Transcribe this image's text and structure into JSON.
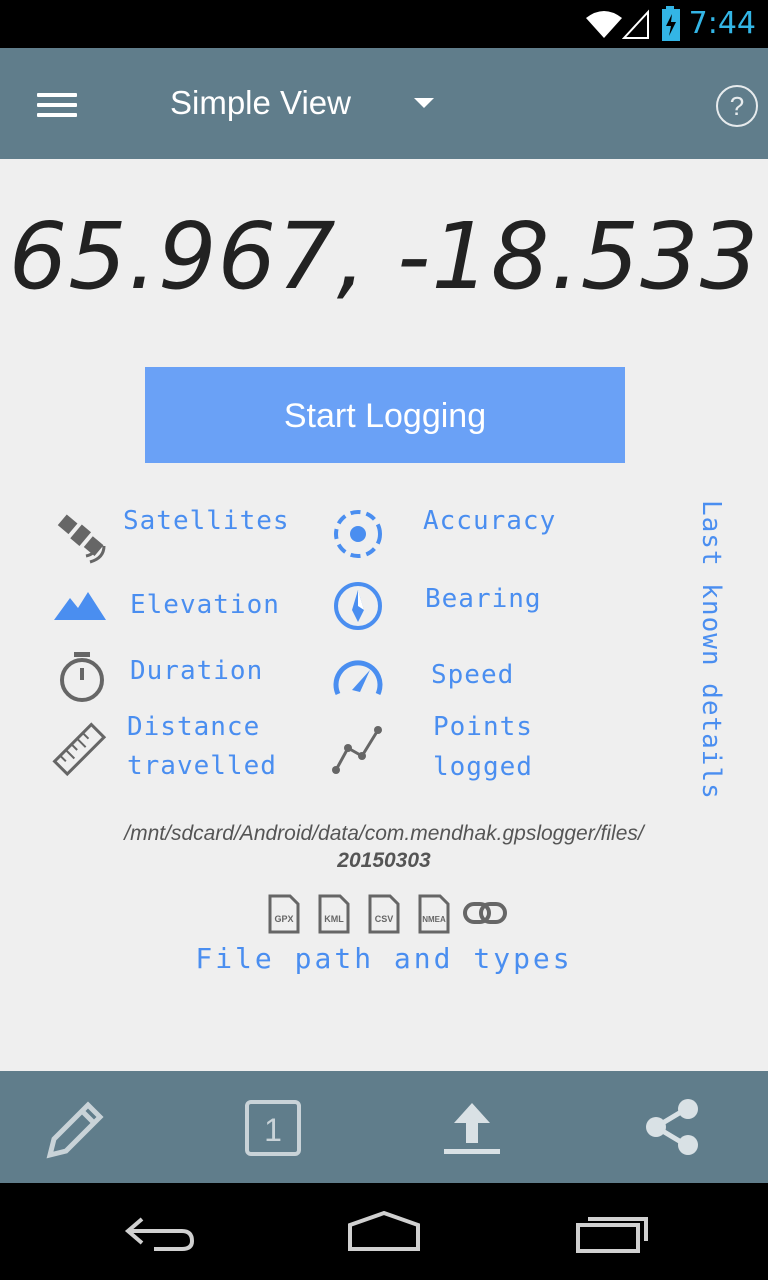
{
  "status_bar": {
    "time": "7:44"
  },
  "app_bar": {
    "title": "Simple View"
  },
  "coordinates": "65.967, -18.533",
  "start_button": {
    "label": "Start Logging"
  },
  "details": {
    "satellites": "Satellites",
    "accuracy": "Accuracy",
    "elevation": "Elevation",
    "bearing": "Bearing",
    "duration": "Duration",
    "speed": "Speed",
    "distance_line1": "Distance",
    "distance_line2": "travelled",
    "points_line1": "Points",
    "points_line2": "logged",
    "last_known": "Last known details"
  },
  "file_info": {
    "path": "/mnt/sdcard/Android/data/com.mendhak.gpslogger/files/",
    "folder": "20150303",
    "types": [
      "GPX",
      "KML",
      "CSV",
      "NMEA"
    ],
    "caption": "File path and types"
  },
  "bottom_bar": {
    "counter": "1"
  },
  "icons": {
    "satellite": "satellite-icon",
    "accuracy": "gps-crosshair-icon",
    "elevation": "mountain-icon",
    "bearing": "compass-icon",
    "duration": "stopwatch-icon",
    "speed": "speedometer-icon",
    "distance": "ruler-icon",
    "points": "polyline-icon",
    "link": "link-icon",
    "edit": "pencil-icon",
    "upload": "upload-icon",
    "share": "share-icon"
  },
  "colors": {
    "app_bar": "#607d8b",
    "accent": "#4a8ef0",
    "button": "#6aa1f6",
    "status_time": "#33b5e5"
  }
}
